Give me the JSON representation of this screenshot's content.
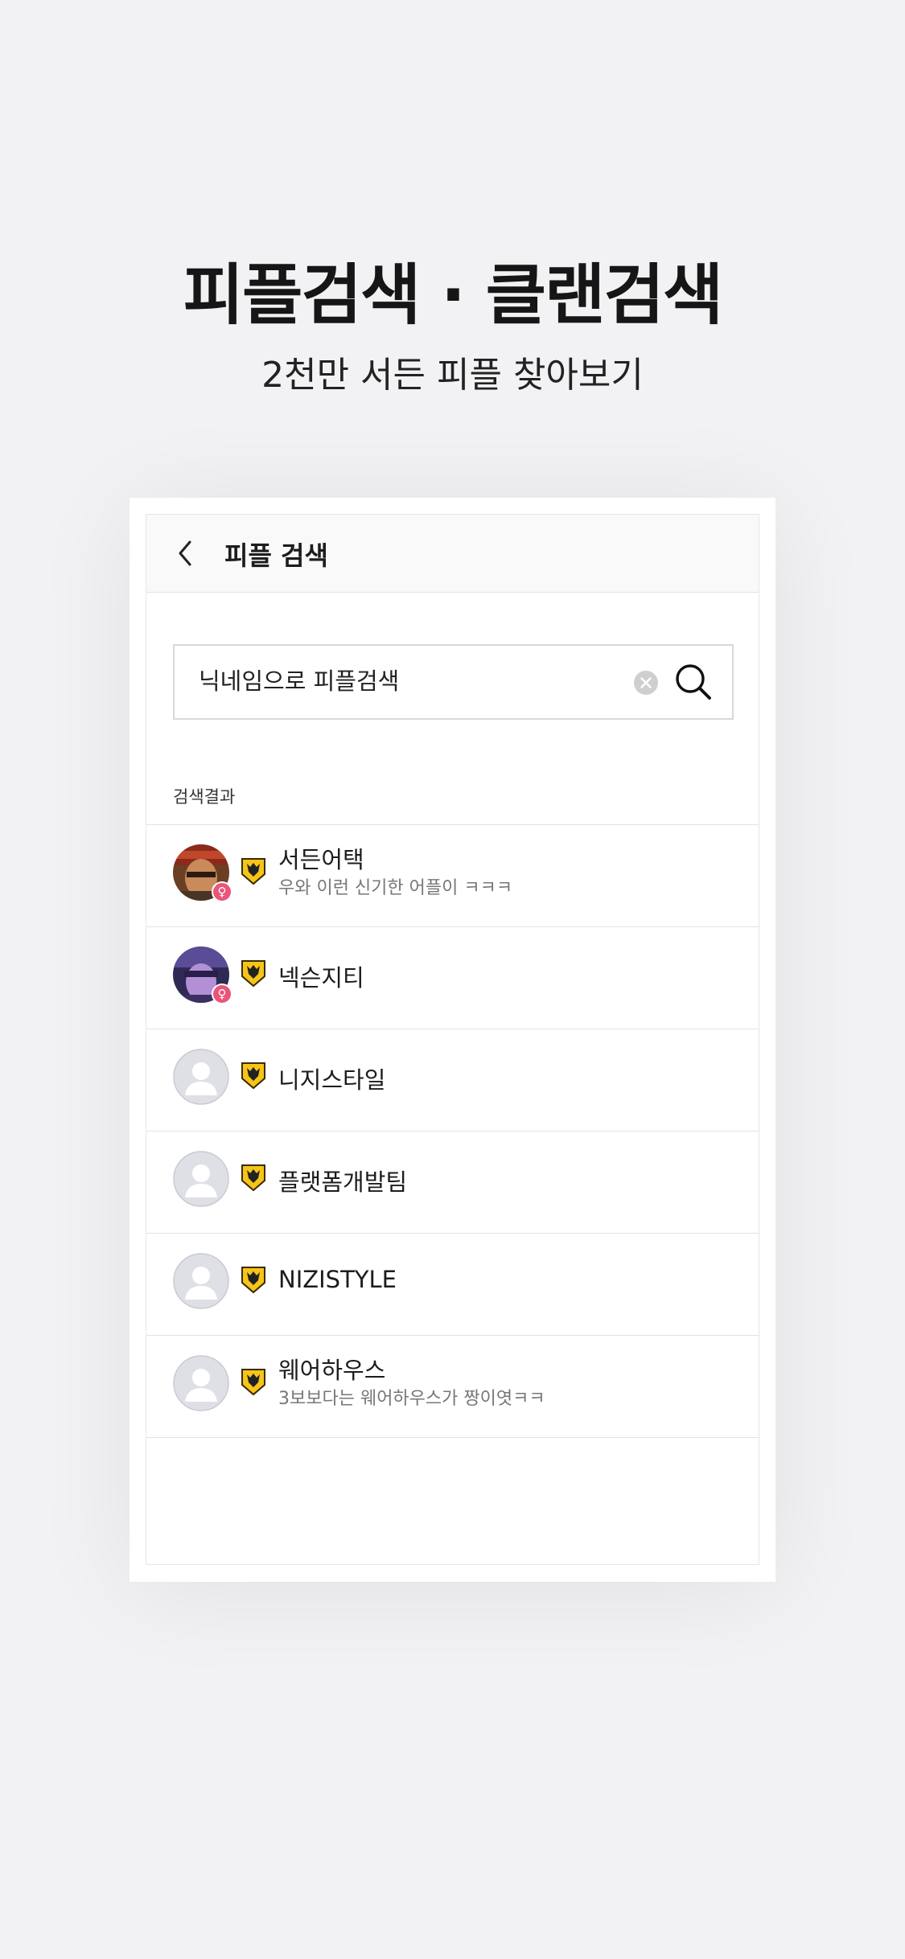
{
  "hero": {
    "title": "피플검색 · 클랜검색",
    "subtitle": "2천만 서든 피플 찾아보기"
  },
  "appbar": {
    "back_icon": "chevron-left-icon",
    "title": "피플 검색"
  },
  "search": {
    "placeholder": "닉네임으로 피플검색",
    "value": "",
    "clear_icon": "clear-circle-icon",
    "search_icon": "search-icon"
  },
  "results": {
    "label": "검색결과",
    "items": [
      {
        "nickname": "서든어택",
        "status": "우와 이런 신기한 어플이 ㅋㅋㅋ",
        "avatar": "photo-soldier-red",
        "gender": "♀",
        "clan_icon": "clan-mark-icon"
      },
      {
        "nickname": "넥슨지티",
        "status": "",
        "avatar": "photo-soldier-purple",
        "gender": "♀",
        "clan_icon": "clan-mark-icon"
      },
      {
        "nickname": "니지스타일",
        "status": "",
        "avatar": "default-avatar",
        "gender": "",
        "clan_icon": "clan-mark-icon"
      },
      {
        "nickname": "플랫폼개발팀",
        "status": "",
        "avatar": "default-avatar",
        "gender": "",
        "clan_icon": "clan-mark-icon"
      },
      {
        "nickname": "NIZISTYLE",
        "status": "",
        "avatar": "default-avatar",
        "gender": "",
        "clan_icon": "clan-mark-icon"
      },
      {
        "nickname": "웨어하우스",
        "status": "3보보다는 웨어하우스가 짱이엿ㅋㅋ",
        "avatar": "default-avatar",
        "gender": "",
        "clan_icon": "clan-mark-icon"
      }
    ]
  },
  "colors": {
    "page_background": "#f2f2f4",
    "gender_female": "#e9557a",
    "clan_gold": "#f5c518"
  }
}
